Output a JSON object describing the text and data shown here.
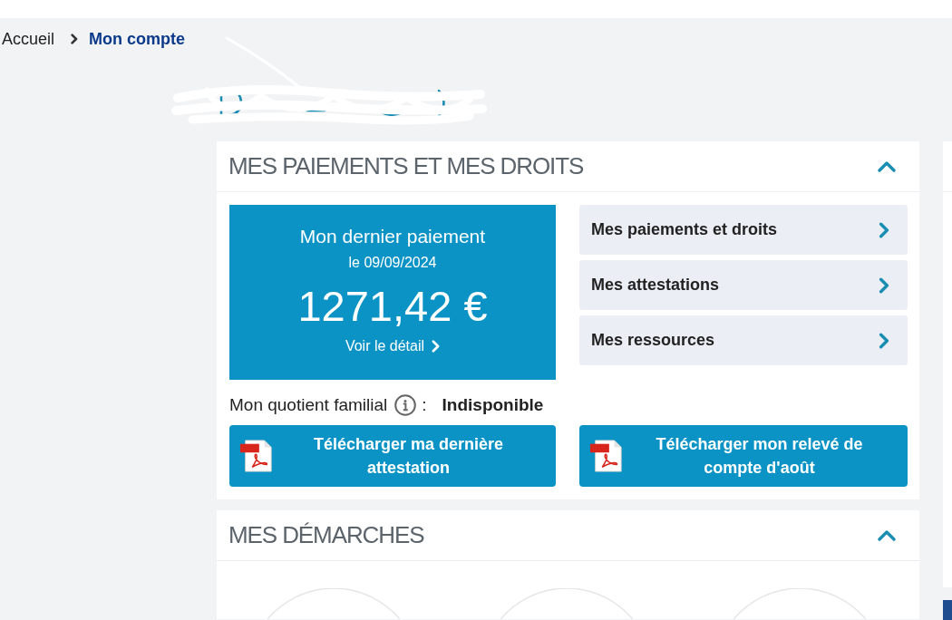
{
  "breadcrumb": [
    {
      "label": "Accueil",
      "current": false
    },
    {
      "label": "Mon compte",
      "current": true
    }
  ],
  "payments_section": {
    "title": "MES PAIEMENTS ET MES DROITS",
    "expanded": true,
    "last_payment": {
      "title": "Mon dernier paiement",
      "date": "le 09/09/2024",
      "amount": "1271,42 €",
      "link": "Voir le détail"
    },
    "links": [
      {
        "label": "Mes paiements et droits"
      },
      {
        "label": "Mes attestations"
      },
      {
        "label": "Mes ressources"
      }
    ],
    "family_quotient": {
      "label": "Mon quotient familial",
      "separator": ":",
      "value": "Indisponible"
    },
    "downloads": [
      {
        "label": "Télécharger ma dernière attestation"
      },
      {
        "label": "Télécharger mon relevé de compte d'août"
      }
    ]
  },
  "procedures_section": {
    "title": "MES DÉMARCHES",
    "expanded": true
  }
}
